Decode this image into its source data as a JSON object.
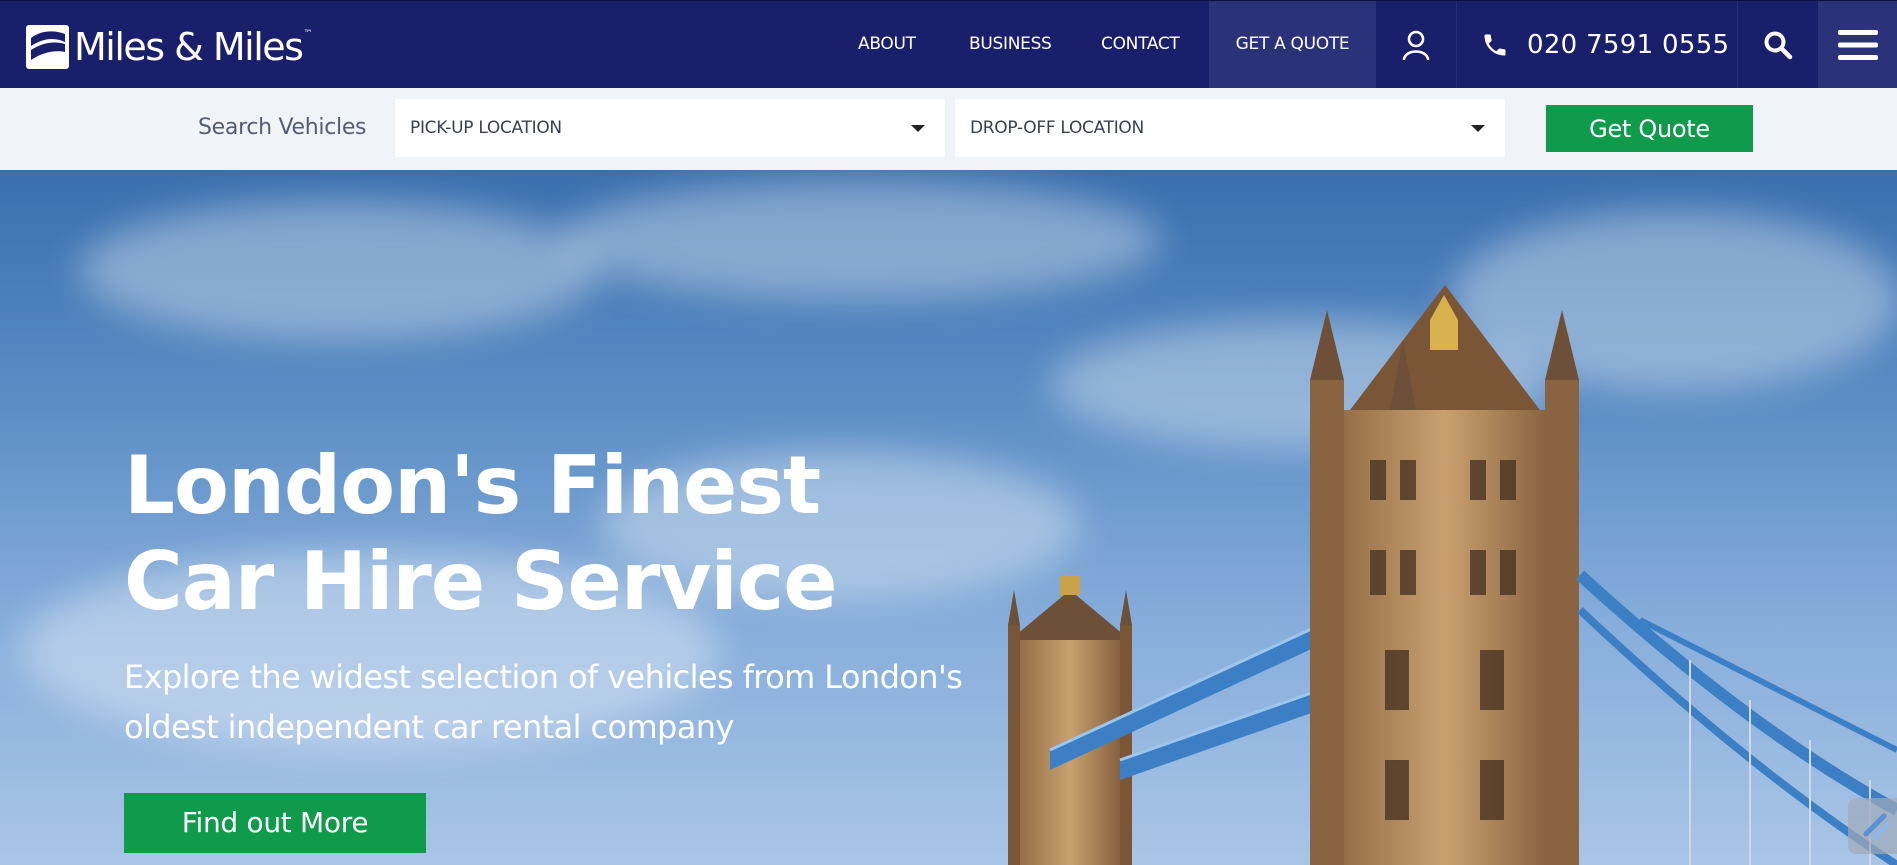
{
  "brand": {
    "name": "Miles & Miles",
    "trademark": "™"
  },
  "nav": {
    "about": "ABOUT",
    "business": "BUSINESS",
    "contact": "CONTACT",
    "get_quote": "GET A QUOTE"
  },
  "header": {
    "phone": "020 7591 0555"
  },
  "search": {
    "label": "Search Vehicles",
    "pickup_placeholder": "PICK-UP LOCATION",
    "dropoff_placeholder": "DROP-OFF LOCATION",
    "button": "Get Quote"
  },
  "hero": {
    "title_line1": "London's Finest",
    "title_line2": "Car Hire Service",
    "subtitle": "Explore the widest selection of vehicles from London's oldest independent car rental company",
    "cta": "Find out More"
  },
  "icons": {
    "logo": "miles-logo-icon",
    "user": "user-icon",
    "phone": "phone-icon",
    "search": "search-icon",
    "menu": "hamburger-menu-icon"
  },
  "colors": {
    "header_bg": "#1a1f6b",
    "active_nav_bg": "#2c3279",
    "cta_green": "#0f9a4c",
    "searchbar_bg": "#f0f3f7"
  }
}
